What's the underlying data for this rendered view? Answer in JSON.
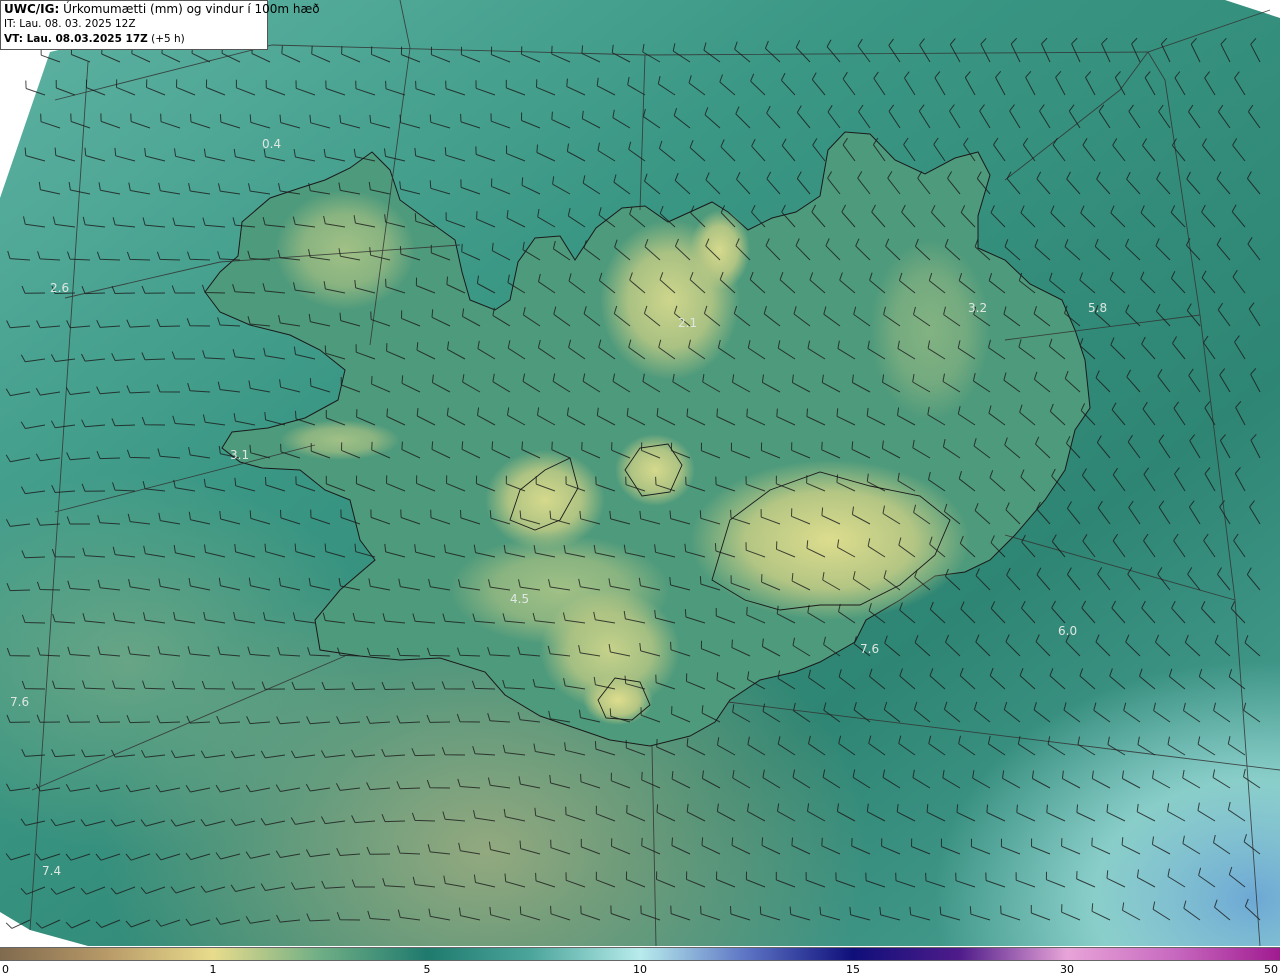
{
  "header": {
    "product_prefix": "UWC/IG:",
    "product_title": " Úrkomumætti (mm) og vindur í 100m hæð",
    "init_time": "IT: Lau. 08. 03. 2025 12Z",
    "valid_prefix": "VT: Lau. 08.03.2025 17Z",
    "valid_suffix": " (+5 h)"
  },
  "field_values": [
    "0.4",
    "2.6",
    "2.1",
    "3.2",
    "5.8",
    "3.1",
    "4.5",
    "6.0",
    "7.6",
    "7.6",
    "7.4"
  ],
  "colorbar": {
    "unit": "mm",
    "ticks": [
      "0",
      "1",
      "5",
      "10",
      "15",
      "30",
      "50"
    ],
    "colors": {
      "0": "#806a4e",
      "1": "#e8dc8c",
      "5": "#1f7a6e",
      "10": "#b8ecec",
      "15": "#0f0f7a",
      "30": "#e8a4d8",
      "50": "#a01a90"
    }
  },
  "map_colors": {
    "sea_dark": "#2f8a78",
    "sea_light": "#7cc4b4",
    "land_low": "#3f8e74",
    "land_high": "#d8d88a",
    "coast": "#1a1a1a",
    "grid": "#3a3a3a"
  }
}
